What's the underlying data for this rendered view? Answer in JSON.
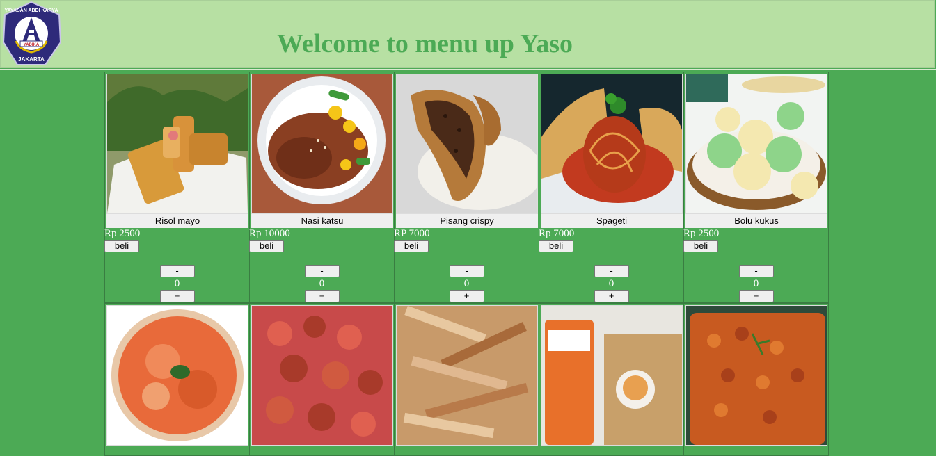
{
  "header": {
    "title": "Welcome to menu up Yaso",
    "logo": {
      "top_text": "YAYASAN ABDI KARYA",
      "badge_text": "YADIKA",
      "bottom_text": "JAKARTA",
      "letter": "A"
    }
  },
  "colors": {
    "page_bg": "#4caa55",
    "header_bg": "#b7e0a3",
    "title": "#4caa55",
    "logo_bg": "#2e2a7a"
  },
  "buttons": {
    "buy_label": "beli",
    "minus_label": "-",
    "plus_label": "+"
  },
  "menu_row_1": [
    {
      "name": "Risol mayo",
      "price": "Rp 2500",
      "qty": "0",
      "image": "risol-mayo-photo"
    },
    {
      "name": "Nasi katsu",
      "price": "Rp 10000",
      "qty": "0",
      "image": "nasi-katsu-photo"
    },
    {
      "name": "Pisang crispy",
      "price": "RP 7000",
      "qty": "0",
      "image": "pisang-crispy-photo"
    },
    {
      "name": "Spageti",
      "price": "Rp 7000",
      "qty": "0",
      "image": "spageti-photo"
    },
    {
      "name": "Bolu kukus",
      "price": "Rp 2500",
      "qty": "0",
      "image": "bolu-kukus-photo"
    }
  ],
  "menu_row_2": [
    {
      "image": "seblak-photo"
    },
    {
      "image": "spicy-sausage-photo"
    },
    {
      "image": "spicy-tofu-strips-photo"
    },
    {
      "image": "muchy-chips-photo"
    },
    {
      "image": "macaroni-photo"
    }
  ]
}
